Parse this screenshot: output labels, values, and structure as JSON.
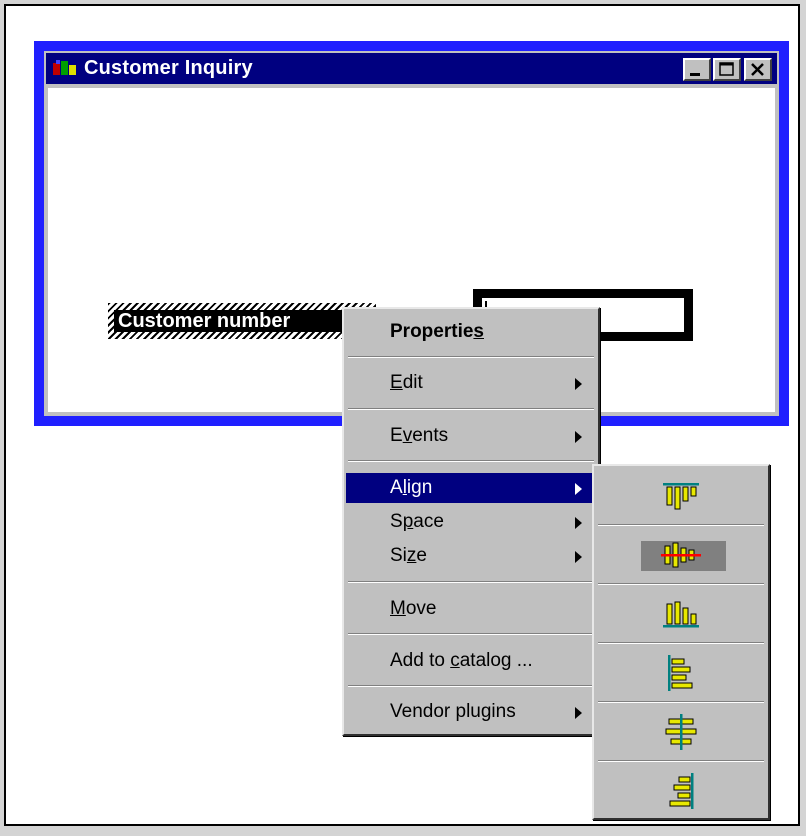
{
  "window": {
    "title": "Customer Inquiry",
    "controls": [
      "minimize",
      "maximize",
      "close"
    ]
  },
  "form": {
    "label_text": "Customer number",
    "entry_value": ""
  },
  "context_menu": {
    "items": [
      {
        "label_pre": "Propertie",
        "mnemonic": "s",
        "label_post": "",
        "bold": true,
        "submenu": false
      },
      {
        "label_pre": "",
        "mnemonic": "E",
        "label_post": "dit",
        "submenu": true
      },
      {
        "label_pre": "E",
        "mnemonic": "v",
        "label_post": "ents",
        "submenu": true
      },
      {
        "label_pre": "A",
        "mnemonic": "l",
        "label_post": "ign",
        "submenu": true,
        "highlighted": true
      },
      {
        "label_pre": "S",
        "mnemonic": "p",
        "label_post": "ace",
        "submenu": true
      },
      {
        "label_pre": "Si",
        "mnemonic": "z",
        "label_post": "e",
        "submenu": true
      },
      {
        "label_pre": "",
        "mnemonic": "M",
        "label_post": "ove",
        "submenu": false
      },
      {
        "label_pre": "Add to ",
        "mnemonic": "c",
        "label_post": "atalog ...",
        "submenu": false
      },
      {
        "label_pre": "Vendor plugins",
        "mnemonic": "",
        "label_post": "",
        "submenu": true
      }
    ]
  },
  "align_submenu": {
    "icons": [
      "align-top-icon",
      "align-middle-horizontal-icon",
      "align-bottom-icon",
      "align-left-icon",
      "align-center-vertical-icon",
      "align-right-icon"
    ],
    "selected_index": 1,
    "colors": {
      "bar": "#e8e800",
      "guide": "#008080",
      "guide_selected": "#ff0000"
    }
  },
  "colors": {
    "window_frame": "#1f1fff",
    "titlebar": "#000080",
    "menu_bg": "#c0c0c0",
    "highlight": "#000080"
  }
}
